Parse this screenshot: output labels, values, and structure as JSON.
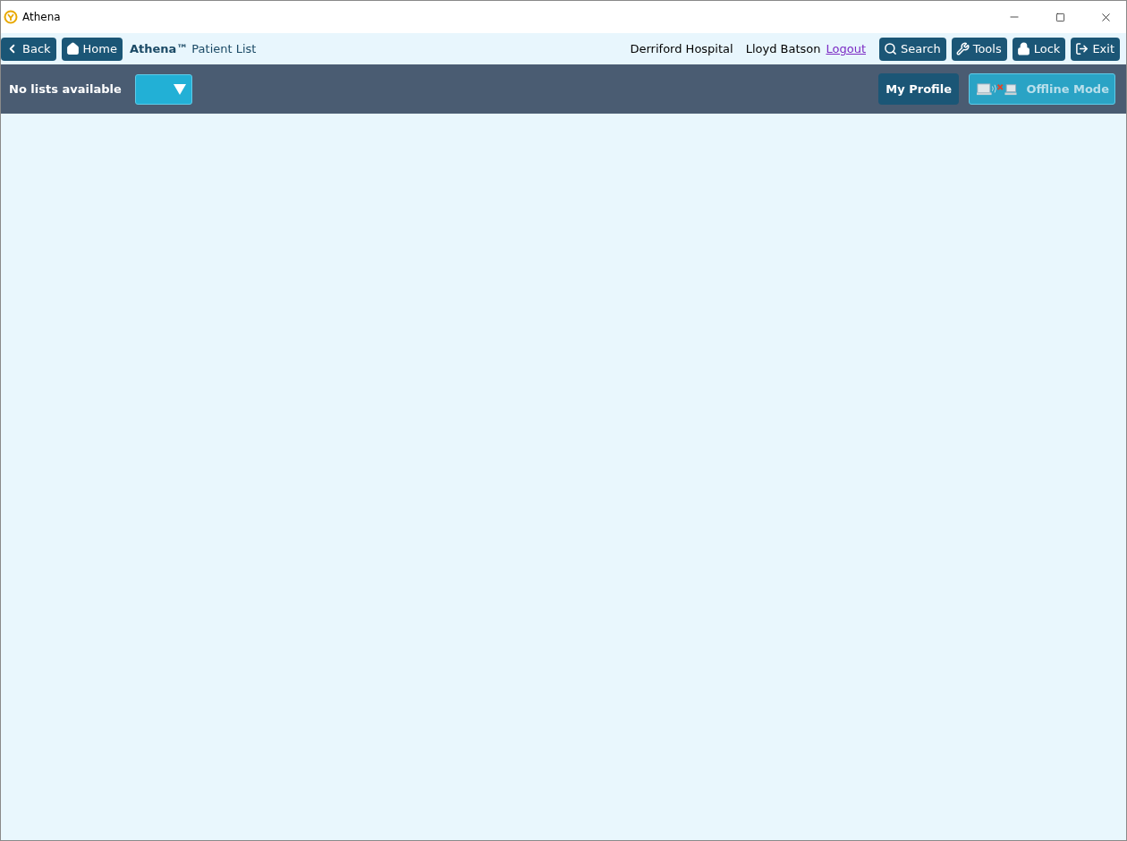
{
  "window": {
    "title": "Athena"
  },
  "nav": {
    "left_buttons": [
      {
        "kind": "back",
        "label": "Back"
      },
      {
        "kind": "home",
        "label": "Home"
      }
    ],
    "brand": "Athena™",
    "page": "Patient List",
    "hospital": "Derriford Hospital",
    "user": "Lloyd Batson",
    "logout": "Logout",
    "right_buttons": [
      {
        "kind": "search",
        "label": "Search"
      },
      {
        "kind": "tools",
        "label": "Tools"
      },
      {
        "kind": "lock",
        "label": "Lock"
      },
      {
        "kind": "exit",
        "label": "Exit"
      }
    ]
  },
  "toolbar": {
    "list_label": "No lists available",
    "profile": "My Profile",
    "offline": {
      "label": "Offline Mode",
      "disabled": true
    }
  }
}
